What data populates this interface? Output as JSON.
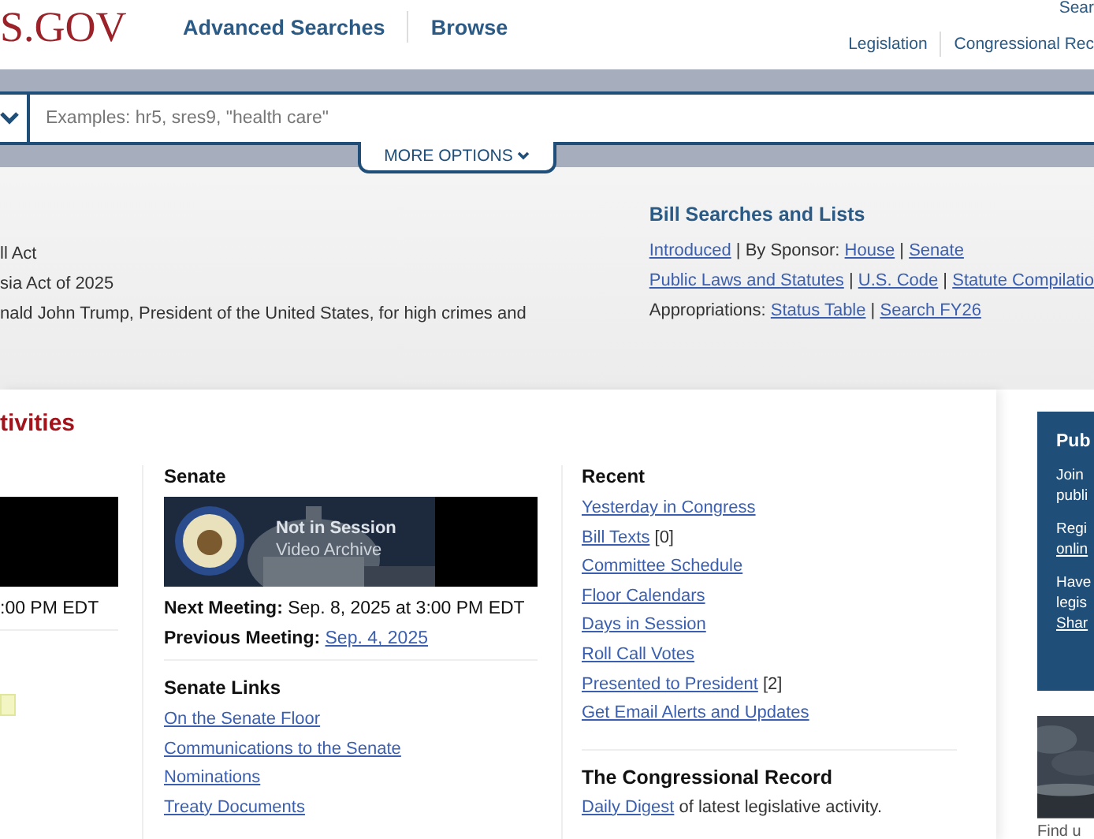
{
  "header": {
    "logo": "S.GOV",
    "nav": [
      "Advanced Searches",
      "Browse"
    ],
    "utility_link": "Sear",
    "utility_nav": [
      "Legislation",
      "Congressional Rec"
    ]
  },
  "search": {
    "placeholder": "Examples: hr5, sres9, \"health care\"",
    "more_options": "MORE OPTIONS"
  },
  "hero": {
    "featured_bills": [
      "ll Act",
      "sia Act of 2025",
      "nald John Trump, President of the United States, for high crimes and"
    ],
    "bill_searches": {
      "title": "Bill Searches and Lists",
      "lines": [
        [
          {
            "text": "Introduced",
            "link": true
          },
          {
            "text": " | By Sponsor: ",
            "link": false
          },
          {
            "text": "House",
            "link": true
          },
          {
            "text": " | ",
            "link": false
          },
          {
            "text": "Senate",
            "link": true
          }
        ],
        [
          {
            "text": "Public Laws and Statutes",
            "link": true
          },
          {
            "text": " | ",
            "link": false
          },
          {
            "text": "U.S. Code",
            "link": true
          },
          {
            "text": " | ",
            "link": false
          },
          {
            "text": "Statute Compilatio",
            "link": true
          }
        ],
        [
          {
            "text": "Appropriations: ",
            "link": false
          },
          {
            "text": "Status Table",
            "link": true
          },
          {
            "text": " | ",
            "link": false
          },
          {
            "text": "Search FY26",
            "link": true
          }
        ]
      ]
    }
  },
  "activities": {
    "title": "tivities",
    "house": {
      "meeting": ":00 PM EDT"
    },
    "senate": {
      "title": "Senate",
      "video_status": "Not in Session",
      "video_caption": "Video Archive",
      "next_label": "Next Meeting:",
      "next_value": "Sep. 8, 2025 at 3:00 PM EDT",
      "previous_label": "Previous Meeting:",
      "previous_link": "Sep. 4, 2025",
      "links_title": "Senate Links",
      "links": [
        "On the Senate Floor",
        "Communications to the Senate",
        "Nominations",
        "Treaty Documents"
      ]
    },
    "recent": {
      "title": "Recent",
      "items": [
        {
          "link": "Yesterday in Congress"
        },
        {
          "link": "Bill Texts",
          "count": "[0]"
        },
        {
          "link": "Committee Schedule"
        },
        {
          "link": "Floor Calendars"
        },
        {
          "link": "Days in Session"
        },
        {
          "link": "Roll Call Votes"
        },
        {
          "link": "Presented to President",
          "count": "[2]"
        },
        {
          "link": "Get Email Alerts and Updates"
        }
      ]
    },
    "congressional_record": {
      "title": "The Congressional Record",
      "link": "Daily Digest",
      "text": " of latest legislative activity."
    }
  },
  "sidebar": {
    "title": "Pub",
    "paragraphs": [
      [
        {
          "text": "Join",
          "link": false
        },
        {
          "text": "publi",
          "link": false
        }
      ],
      [
        {
          "text": "Regi",
          "link": false
        },
        {
          "text": "onlin",
          "link": true
        }
      ],
      [
        {
          "text": "Have",
          "link": false
        },
        {
          "text": "legis",
          "link": false
        },
        {
          "text": "Shar",
          "link": true
        }
      ]
    ],
    "image": {
      "kind": "picture"
    },
    "caption": "Find u"
  }
}
